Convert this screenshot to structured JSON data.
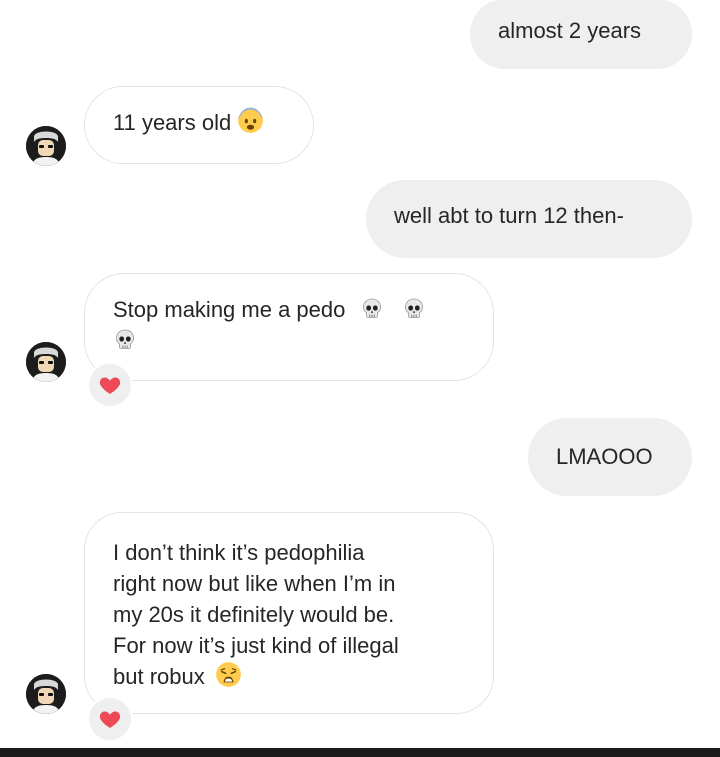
{
  "messages": [
    {
      "text": "almost 2 years",
      "direction": "sent"
    },
    {
      "text": "11 years old",
      "direction": "received",
      "emoji": [
        "fearful-face"
      ]
    },
    {
      "text": "well abt to turn 12 then-",
      "direction": "sent"
    },
    {
      "text": "Stop making me a pedo",
      "direction": "received",
      "emoji": [
        "skull",
        "skull",
        "skull"
      ],
      "reaction": "red-heart"
    },
    {
      "text": "LMAOOO",
      "direction": "sent"
    },
    {
      "text": "I don’t think it’s pedophilia\nright now but like when I’m in\nmy 20s it definitely would be.\nFor now it’s just kind of illegal\nbut robux",
      "direction": "received",
      "emoji": [
        "weary-face"
      ],
      "reaction": "red-heart"
    }
  ],
  "colors": {
    "sent_bubble": "#efefef",
    "received_border": "#e4e4e4",
    "text": "#262626",
    "heart": "#ed4956"
  }
}
